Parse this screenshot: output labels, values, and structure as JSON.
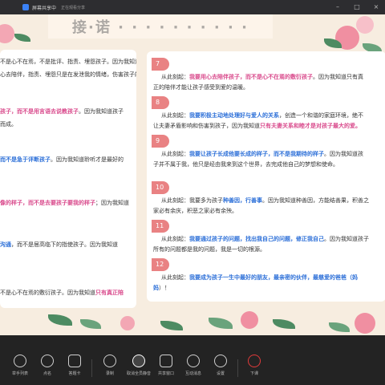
{
  "window": {
    "title": "屏幕共享中",
    "meta": "正在观看分享"
  },
  "slide": {
    "title_fragment": "接·诺 · · · · · · · · · ·"
  },
  "left_panel": {
    "rows": [
      {
        "pre": "不是心不在焉，不是批评、指责、埋怨孩子。因为我知道只有耐",
        "hl": "",
        "post": ""
      },
      {
        "pre": "心去陪伴，指责、埋怨只是在发泄我的情绪，伤害孩子的心",
        "hl": "",
        "post": ""
      },
      {
        "pre": "",
        "hl": "孩子，而不是用言语去说教孩子",
        "post": "。因为我知道孩子"
      },
      {
        "pre": "而成。",
        "hl": "",
        "post": ""
      },
      {
        "pre": "",
        "hl": "而不是急于评断孩子",
        "post": "。因为我知道聆听才是最好的"
      },
      {
        "pre": "",
        "hl": "像的样子，而不是去要孩子要我的样子",
        "post": "；因为我知道"
      },
      {
        "pre": "",
        "hl": "沟通",
        "post": "，而不是居高临下的指使孩子。因为我知道"
      },
      {
        "pre": "不是心不在焉的敷衍孩子。因为我知道",
        "hl": "只有真正陪",
        "post": ""
      }
    ]
  },
  "right_panel": {
    "items": [
      {
        "num": "7",
        "lines": [
          {
            "pre": "从此刻起：",
            "hl": "我要用心去陪伴孩子，而不是心不在焉的敷衍孩子",
            "post": "。因为我知道只有真"
          },
          {
            "pre": "正的陪伴才能让孩子感受到爱的温暖。",
            "hl": "",
            "post": ""
          }
        ]
      },
      {
        "num": "8",
        "lines": [
          {
            "pre": "从此刻起：",
            "hl": "我要积极主动地处理好与爱人的关系",
            "post": "，创造一个和谐的家庭环境，绝不"
          },
          {
            "pre": "让夫妻矛盾影响和伤害到孩子，因为我知道",
            "hl": "只有夫妻关系和睦才是对孩子最大的爱。",
            "post": ""
          }
        ]
      },
      {
        "num": "9",
        "lines": [
          {
            "pre": "从此刻起：",
            "hl": "我要让孩子长成他要长成的样子，而不是我期待的样子",
            "post": "。因为我知道孩"
          },
          {
            "pre": "子并不属于我，他只是经由我来到这个世界，去完成他自己的梦想和使命。",
            "hl": "",
            "post": ""
          }
        ]
      },
      {
        "num": "10",
        "lines": [
          {
            "pre": "从此刻起：我要多为孩子",
            "hl": "种善因，行善事",
            "post": "。因为我知道种善因，方能结善果，积善之"
          },
          {
            "pre": "家必有余庆，积恶之家必有余殃。",
            "hl": "",
            "post": ""
          }
        ]
      },
      {
        "num": "11",
        "lines": [
          {
            "pre": "从此刻起：",
            "hl": "我要通过孩子的问题，找出我自己的问题，修正我自己",
            "post": "。因为我知道孩子"
          },
          {
            "pre": "所有的问题都是我的问题，我是一切的根源。",
            "hl": "",
            "post": ""
          }
        ]
      },
      {
        "num": "12",
        "lines": [
          {
            "pre": "从此刻起：",
            "hl": "我要成为孩子一生中最好的朋友，最亲密的伙伴，最慈爱的爸爸（妈",
            "post": ""
          },
          {
            "pre": "",
            "hl": "妈",
            "post": "）！"
          }
        ]
      }
    ]
  },
  "bottombar": {
    "items": [
      {
        "label": "举手列表",
        "icon": "hand-list-icon"
      },
      {
        "label": "点名",
        "icon": "pin-icon"
      },
      {
        "label": "答题卡",
        "icon": "card-icon"
      },
      {
        "label": "录制",
        "icon": "record-icon"
      },
      {
        "label": "取消全员静音",
        "icon": "unmute-all-icon"
      },
      {
        "label": "共享窗口",
        "icon": "share-window-icon"
      },
      {
        "label": "互动消息",
        "icon": "chat-icon"
      },
      {
        "label": "设置",
        "icon": "gear-icon"
      },
      {
        "label": "下课",
        "icon": "power-icon"
      }
    ]
  },
  "colors": {
    "highlight_pink": "#d94a8c",
    "highlight_blue": "#2c6fd8",
    "badge": "#e98283"
  }
}
